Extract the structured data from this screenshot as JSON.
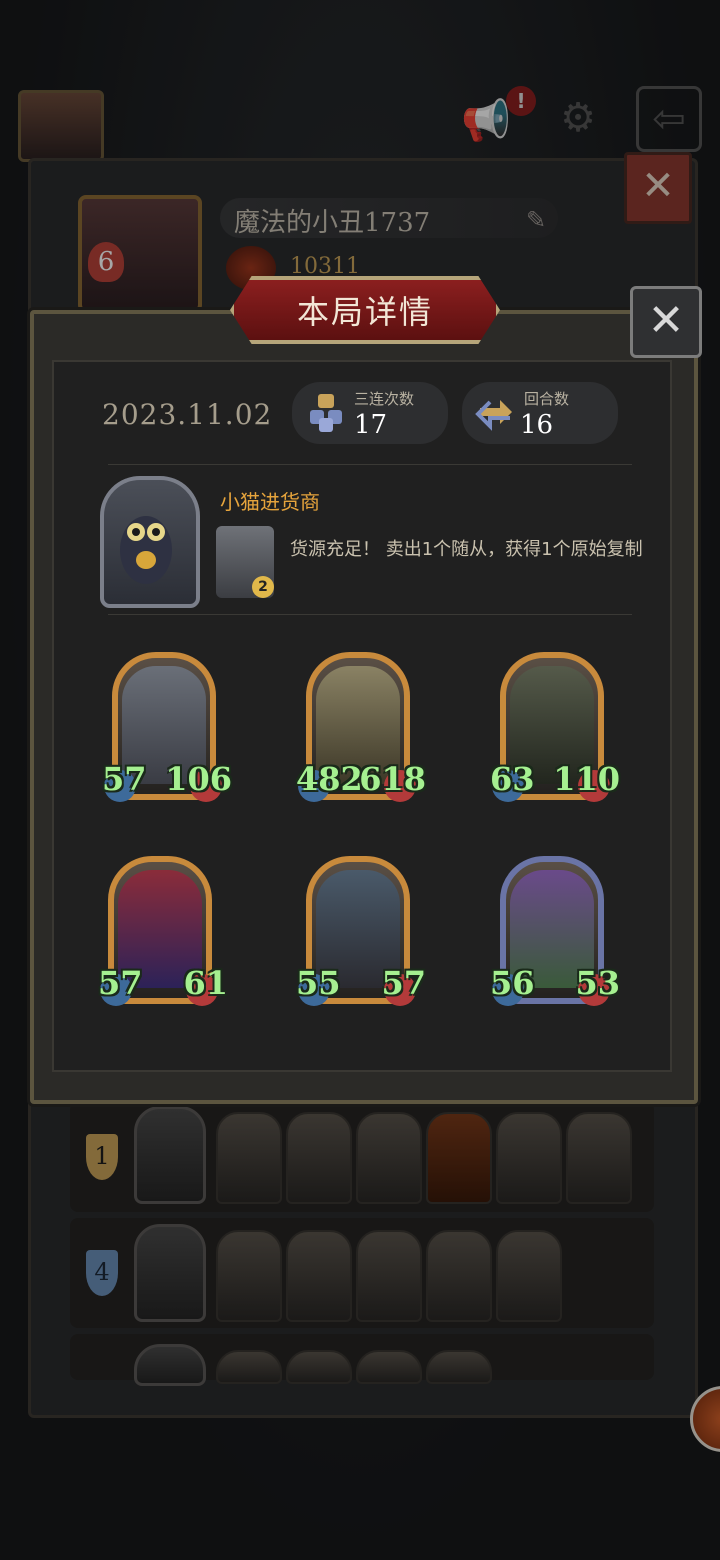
{
  "profile": {
    "name": "魔法的小丑1737",
    "score": "10311",
    "level": "6",
    "notification": "!"
  },
  "modal": {
    "title": "本局详情",
    "date": "2023.11.02",
    "stats": [
      {
        "label": "三连次数",
        "value": "17"
      },
      {
        "label": "回合数",
        "value": "16"
      }
    ],
    "hero": {
      "name": "小猫进货商",
      "skill_level": "2",
      "skill_text": "货源充足！ 卖出1个随从，获得1个原始复制"
    },
    "units": [
      {
        "atk": "57",
        "hp": "106",
        "frame": "gold"
      },
      {
        "atk": "482",
        "hp": "618",
        "frame": "gold"
      },
      {
        "atk": "63",
        "hp": "110",
        "frame": "gold"
      },
      {
        "atk": "57",
        "hp": "61",
        "frame": "gold"
      },
      {
        "atk": "55",
        "hp": "57",
        "frame": "gold"
      },
      {
        "atk": "56",
        "hp": "53",
        "frame": "blue"
      }
    ]
  },
  "history": [
    {
      "rank": "1",
      "count": 6
    },
    {
      "rank": "4",
      "count": 5
    },
    {
      "rank": "",
      "count": 4
    }
  ],
  "colors": {
    "accent_red": "#8b1f1f",
    "hero_name": "#e6a43c",
    "stat_green": "#a5f090",
    "gold_frame": "#c88a3c",
    "blue_frame": "#6a74a6"
  }
}
